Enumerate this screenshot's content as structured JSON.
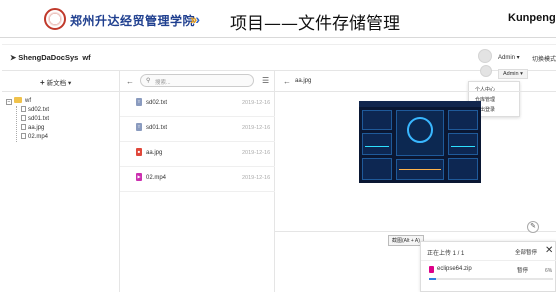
{
  "slide": {
    "school_name": "郑州升达经贸管理学院",
    "chevrons": "›››",
    "title": "项目——文件存储管理",
    "brand_right": "Kunpeng"
  },
  "app": {
    "brand": "ShengDaDocSys",
    "workspace": "wf",
    "user": "Admin",
    "switch_mode": "切换模式",
    "user_menu_label": "Admin",
    "user_menu_items": [
      "个人中心",
      "仓库管理",
      "退出登录"
    ]
  },
  "tree": {
    "new_doc_label": "新文档",
    "root": "wf",
    "children": [
      "sd02.txt",
      "sd01.txt",
      "aa.jpg",
      "02.mp4"
    ]
  },
  "file_list": {
    "search_placeholder": "搜索...",
    "files": [
      {
        "name": "sd02.txt",
        "date": "2019-12-16",
        "type": "txt",
        "color": "#8a9bbf"
      },
      {
        "name": "sd01.txt",
        "date": "2019-12-16",
        "type": "txt",
        "color": "#8a9bbf"
      },
      {
        "name": "aa.jpg",
        "date": "2019-12-16",
        "type": "jpg",
        "color": "#e0473a"
      },
      {
        "name": "02.mp4",
        "date": "2019-12-16",
        "type": "mp4",
        "color": "#cc2fb0"
      }
    ]
  },
  "preview": {
    "file_name": "aa.jpg"
  },
  "tooltip": "截图(Alt + A)",
  "upload": {
    "title": "正在上传 1 / 1",
    "pause_all": "全部暂停",
    "file_name": "eclipse64.zip",
    "pause": "暂停",
    "percent": "6%",
    "progress": 0.06
  },
  "colors": {
    "accent": "#2f7ee0",
    "school": "#1f3f8f",
    "folder": "#f0c24b"
  }
}
